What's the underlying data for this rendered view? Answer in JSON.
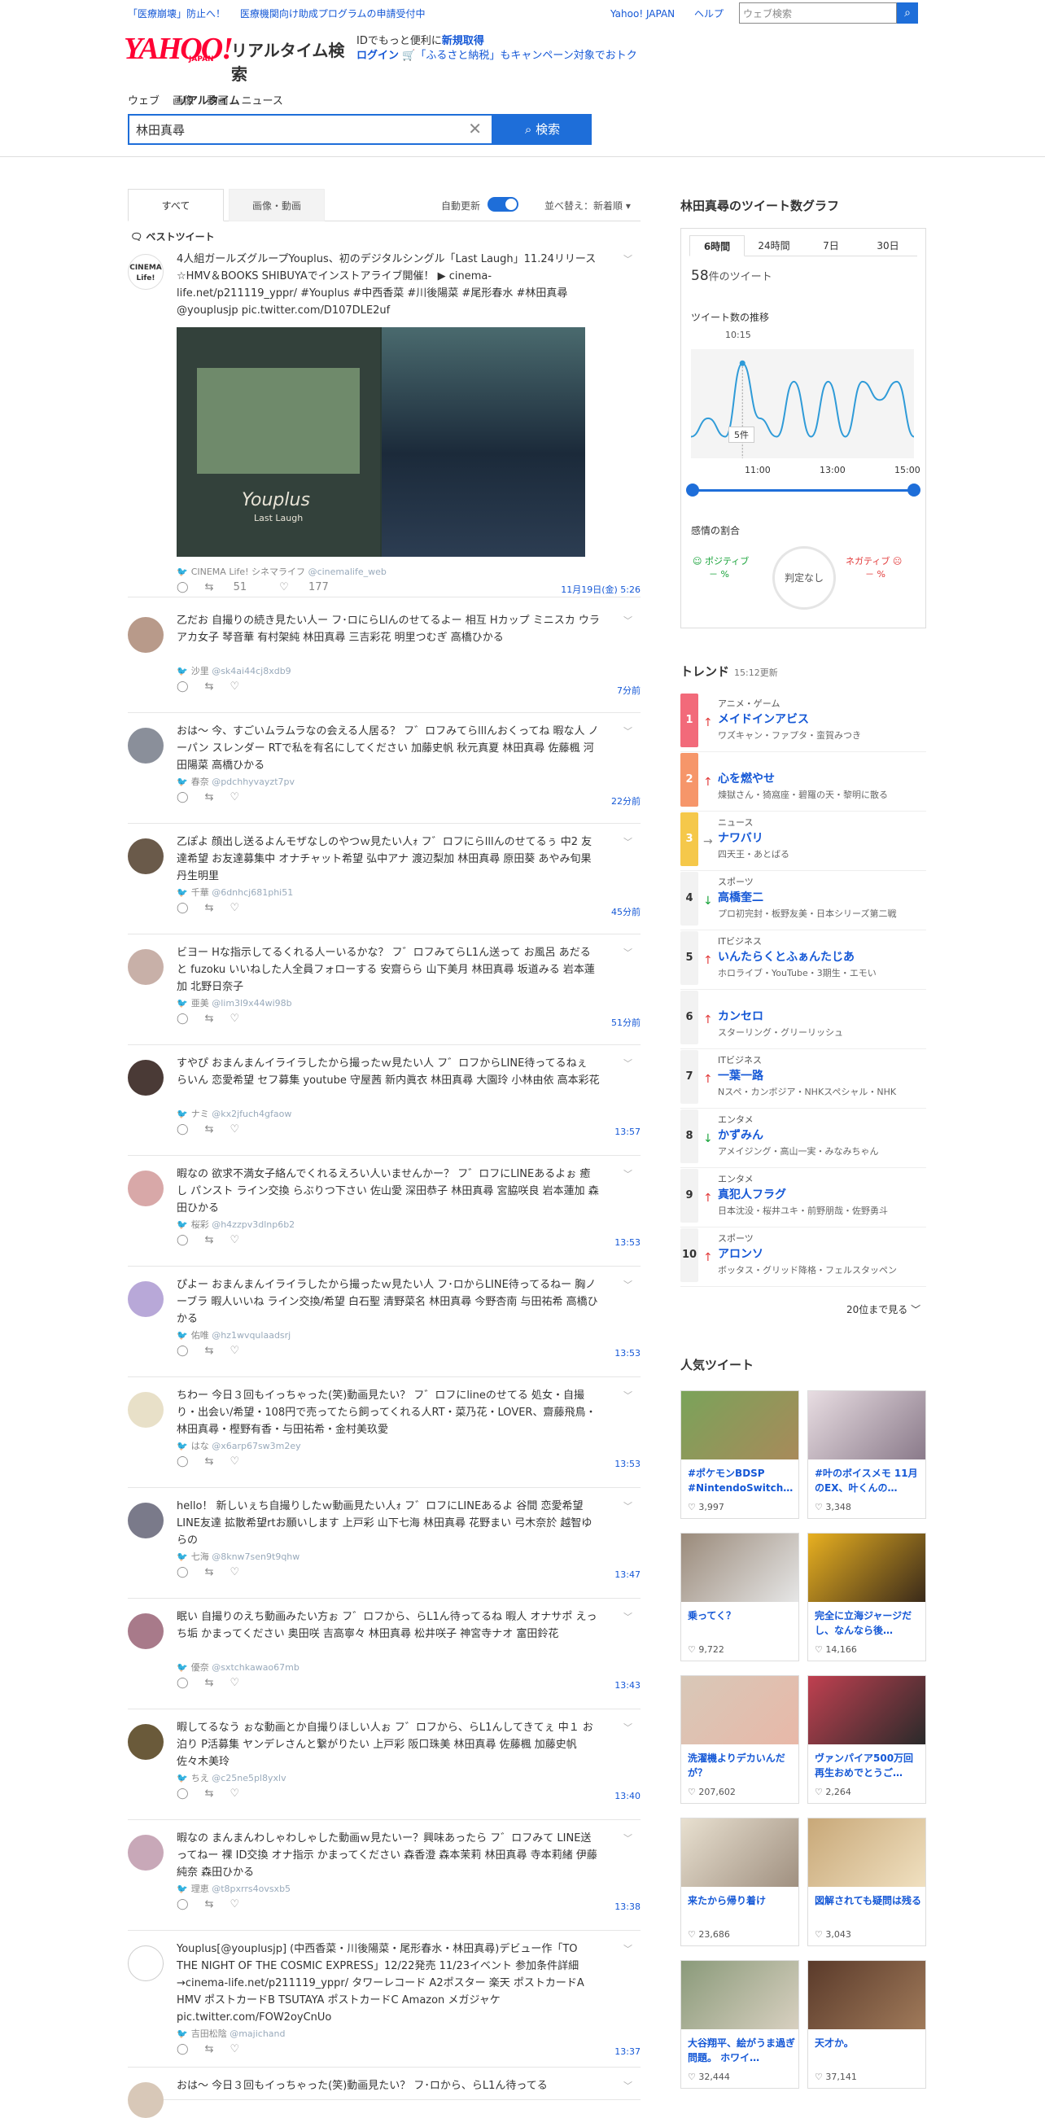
{
  "header": {
    "promo1": "「医療崩壊」防止へ！",
    "promo2": "医療機関向け助成プログラムの申請受付中",
    "link_yahoo": "Yahoo! JAPAN",
    "link_help": "ヘルプ",
    "search_placeholder": "ウェブ検索",
    "logo": "YAHOO!",
    "logo_jp": "JAPAN",
    "service": "リアルタイム検索",
    "login_line1_pre": "IDでもっと便利に",
    "login_line1_link": "新規取得",
    "login_line2_link": "ログイン",
    "login_line2_text": "🛒「ふるさと納税」もキャンペーン対象でおトク"
  },
  "tabs": [
    "ウェブ",
    "画像",
    "動画",
    "リアルタイム",
    "ニュース"
  ],
  "search": {
    "query": "林田真尋",
    "button": "検索"
  },
  "filter": {
    "all": "すべて",
    "media": "画像・動画",
    "auto": "自動更新",
    "sort": "並べ替え：新着順"
  },
  "best_label": "ベストツイート",
  "tweets": [
    {
      "text": "4人組ガールズグループYouplus、初のデジタルシングル「Last Laugh」11.24リリース ☆HMV＆BOOKS SHIBUYAでインストアライブ開催！ ▶ cinema-life.net/p211119_yppr/ #Youplus #中西香菜 #川後陽菜 #尾形春水 #林田真尋 @youplusjp pic.twitter.com/D107DLE2uf",
      "name": "CINEMA Life! シネマライフ",
      "handle": "@cinemalife_web",
      "rt": "51",
      "like": "177",
      "time": "11月19日(金) 5:26",
      "img_title": "Youplus",
      "img_sub": "Last Laugh"
    },
    {
      "text": "乙だお 自撮りの続き見たい人ー フ･ロにらLlんのせてるよー 相互 Hカップ ミニスカ ウラアカ女子 琴音華 有村架純 林田真尋 三吉彩花 明里つむぎ 高橋ひかる",
      "name": "沙里",
      "handle": "@sk4ai44cj8xdb9",
      "time": "7分前"
    },
    {
      "text": "おは～ 今、すごいムラムラなの会える人居る？ フ゛ロフみてらlllんおくってね 暇な人 ノーパン スレンダー RTで私を有名にしてください 加藤史帆 秋元真夏 林田真尋 佐藤楓 河田陽菜 高橋ひかる",
      "name": "春奈",
      "handle": "@pdchhyvayzt7pv",
      "time": "22分前"
    },
    {
      "text": "乙ぽよ 顔出し送るよんモザなしのやつｗ見たい人ｫ フ゛ロフにらlllんのせてるぅ 中2 友達希望 お友達募集中 オナチャット希望 弘中アナ 渡辺梨加 林田真尋 原田葵 あやみ旬果 丹生明里",
      "name": "千華",
      "handle": "@6dnhcj681phi51",
      "time": "45分前"
    },
    {
      "text": "ビヨー Hな指示してるくれる人ーいるかな？ フ゛ロフみてらL1ん送って お風呂 あだると fuzoku いいねした人全員フォローする 安齋らら 山下美月 林田真尋 坂道みる 岩本蓮加 北野日奈子",
      "name": "亜美",
      "handle": "@lim3l9x44wi98b",
      "time": "51分前"
    },
    {
      "text": "すやぴ おまんまんイライラしたから撮ったｗ見たい人 フ゛ロフからLINE待ってるねぇ らいん 恋愛希望 セフ募集 youtube 守屋茜 新内眞衣 林田真尋 大園玲 小林由依 高本彩花",
      "name": "ナミ",
      "handle": "@kx2jfuch4gfaow",
      "time": "13:57"
    },
    {
      "text": "暇なの 欲求不満女子絡んでくれるえろい人いませんかー？ フ゛ロフにLINEあるよぉ 癒し パンスト ライン交換 らぶりつ下さい 佐山愛 深田恭子 林田真尋 宮脇咲良 岩本蓮加 森田ひかる",
      "name": "桜彩",
      "handle": "@h4zzpv3dlnp6b2",
      "time": "13:53"
    },
    {
      "text": "ぴよー おまんまんイライラしたから撮ったｗ見たい人 フ･ロからLINE待ってるねー 胸ノーブラ 暇人いいね ライン交換/希望 白石聖 清野菜名 林田真尋 今野杏南 与田祐希 高橋ひかる",
      "name": "佑唯",
      "handle": "@hz1wvqulaadsrj",
      "time": "13:53"
    },
    {
      "text": "ちわー 今日３回もイっちゃった(笑)動画見たい？ フ゛ロフにlineのせてる 処女・自撮り・出会い/希望・108円で売ってたら飼ってくれる人RT・菜乃花・LOVER、齋藤飛鳥・林田真尋・樫野有香・与田祐希・金村美玖愛",
      "name": "はな",
      "handle": "@x6arp67sw3m2ey",
      "time": "13:53"
    },
    {
      "text": "hello！ 新しいぇち自撮りしたｗ動画見たい人ｫ フ゛ロフにLINEあるよ 谷間 恋愛希望 LINE友達 拡散希望rtお願いします 上戸彩 山下七海 林田真尋 花野まい 弓木奈於 越智ゆらの",
      "name": "七海",
      "handle": "@8knw7sen9t9qhw",
      "time": "13:47"
    },
    {
      "text": "眠い 自撮りのえち動画みたい方ぉ フ゛ロフから、らL1ん待ってるね 暇人 オナサポ えっち垢 かまってください 奥田咲 吉高寧々 林田真尋 松井咲子 神宮寺ナオ 富田鈴花",
      "name": "優奈",
      "handle": "@sxtchkawao67mb",
      "time": "13:43"
    },
    {
      "text": "暇してるなう ぉな動画とか自撮りほしい人ぉ フ゛ロフから、らL1んしてきてぇ 中１ お泊り P活募集 ヤンデレさんと繋がりたい 上戸彩 阪口珠美 林田真尋 佐藤楓 加藤史帆 佐々木美玲",
      "name": "ちえ",
      "handle": "@c25ne5pl8yxlv",
      "time": "13:40"
    },
    {
      "text": "暇なの まんまんわしゃわしゃした動画ｗ見たいー？興味あったら フ゛ロフみて LINE送ってねー 裸 ID交換 オナ指示 かまってください 森香澄 森本茉莉 林田真尋 寺本莉緒 伊藤純奈 森田ひかる",
      "name": "理恵",
      "handle": "@t8pxrrs4ovsxb5",
      "time": "13:38"
    },
    {
      "text": "Youplus[@youplusjp] (中西香菜・川後陽菜・尾形春水・林田真尋)デビュー作「TO THE NIGHT OF THE COSMIC EXPRESS」12/22発売 11/23イベント 参加条件詳細→cinema-life.net/p211119_yppr/ タワーレコード A2ポスター 楽天 ポストカードA HMV ポストカードB TSUTAYA ポストカードC Amazon メガジャケ pic.twitter.com/FOW2oyCnUo",
      "name": "吉田松陰",
      "handle": "@majichand",
      "time": "13:37"
    },
    {
      "text": "おは～ 今日３回もイっちゃった(笑)動画見たい？ フ･ロから、らL1ん待ってる"
    }
  ],
  "graph": {
    "title": "林田真尋のツイート数グラフ",
    "tabs": [
      "6時間",
      "24時間",
      "7日",
      "30日"
    ],
    "count": "58",
    "count_suffix": "件のツイート",
    "sub": "ツイート数の推移",
    "peak_time": "10:15",
    "peak_label": "5件",
    "ticks": [
      "11:00",
      "13:00",
      "15:00"
    ],
    "emo_label": "感情の割合",
    "pos": "ポジティブ",
    "neg": "ネガティブ",
    "pos_val": "－ %",
    "neg_val": "－ %",
    "neutral": "判定なし"
  },
  "chart_data": {
    "type": "line",
    "x": [
      "09:00",
      "09:30",
      "10:00",
      "10:15",
      "10:30",
      "11:00",
      "11:30",
      "12:00",
      "12:30",
      "13:00",
      "13:30",
      "14:00",
      "14:30",
      "15:00"
    ],
    "values": [
      1,
      2,
      1,
      5,
      2,
      1,
      4,
      1,
      4,
      1,
      4,
      3,
      4,
      1
    ],
    "xlim_ticks": [
      "11:00",
      "13:00",
      "15:00"
    ]
  },
  "trend": {
    "title": "トレンド",
    "updated": "15:12更新",
    "more": "20位まで見る",
    "items": [
      {
        "rank": "1",
        "cat": "アニメ・ゲーム",
        "kw": "メイドインアビス",
        "rel": "ワズキャン・ファプタ・蛮賀みつき",
        "color": "#f26a7a",
        "arrow": "↑",
        "ac": "#e23a3a"
      },
      {
        "rank": "2",
        "cat": "",
        "kw": "心を燃やせ",
        "rel": "煉獄さん・猗窩座・碧羅の天・黎明に散る",
        "color": "#f6966a",
        "arrow": "↑",
        "ac": "#e23a3a"
      },
      {
        "rank": "3",
        "cat": "ニュース",
        "kw": "ナワバリ",
        "rel": "四天王・あとばる",
        "color": "#f5c84a",
        "arrow": "→",
        "ac": "#888"
      },
      {
        "rank": "4",
        "cat": "スポーツ",
        "kw": "高橋奎二",
        "rel": "プロ初完封・板野友美・日本シリーズ第二戦",
        "color": "#f2f2f2",
        "arrow": "↓",
        "ac": "#18a33a"
      },
      {
        "rank": "5",
        "cat": "ITビジネス",
        "kw": "いんたらくとふぁんたじあ",
        "rel": "ホロライブ・YouTube・3期生・エモい",
        "color": "#f2f2f2",
        "arrow": "↑",
        "ac": "#e23a3a"
      },
      {
        "rank": "6",
        "cat": "",
        "kw": "カンセロ",
        "rel": "スターリング・グリーリッシュ",
        "color": "#f2f2f2",
        "arrow": "↑",
        "ac": "#e23a3a"
      },
      {
        "rank": "7",
        "cat": "ITビジネス",
        "kw": "一葉一路",
        "rel": "Nスペ・カンボジア・NHKスペシャル・NHK",
        "color": "#f2f2f2",
        "arrow": "↑",
        "ac": "#e23a3a"
      },
      {
        "rank": "8",
        "cat": "エンタメ",
        "kw": "かずみん",
        "rel": "アメイジング・高山一実・みなみちゃん",
        "color": "#f2f2f2",
        "arrow": "↓",
        "ac": "#18a33a"
      },
      {
        "rank": "9",
        "cat": "エンタメ",
        "kw": "真犯人フラグ",
        "rel": "日本沈没・桜井ユキ・前野朋哉・佐野勇斗",
        "color": "#f2f2f2",
        "arrow": "↑",
        "ac": "#e23a3a"
      },
      {
        "rank": "10",
        "cat": "スポーツ",
        "kw": "アロンソ",
        "rel": "ボッタス・グリッド降格・フェルスタッペン",
        "color": "#f2f2f2",
        "arrow": "↑",
        "ac": "#e23a3a"
      }
    ]
  },
  "popular": {
    "title": "人気ツイート",
    "cards": [
      {
        "title": "#ポケモンBDSP #NintendoSwitch…",
        "likes": "3,997",
        "c1": "#7aa35a",
        "c2": "#a88a5a"
      },
      {
        "title": "#叶のボイスメモ 11月のEX、叶くんの…",
        "likes": "3,348",
        "c1": "#e8dde2",
        "c2": "#8a7a8a"
      },
      {
        "title": "乗ってく？",
        "likes": "9,722",
        "c1": "#9a8a7a",
        "c2": "#e6e6e6"
      },
      {
        "title": "完全に立海ジャージだし、なんなら後…",
        "likes": "14,166",
        "c1": "#e8b020",
        "c2": "#3a2a1a"
      },
      {
        "title": "洗濯機よりデカいんだが？",
        "likes": "207,602",
        "c1": "#d8c8b8",
        "c2": "#e8b8a8"
      },
      {
        "title": "ヴァンパイア500万回再生おめでとうご…",
        "likes": "2,264",
        "c1": "#c04050",
        "c2": "#2a2a2a"
      },
      {
        "title": "来たから帰り着け",
        "likes": "23,686",
        "c1": "#e8e0d0",
        "c2": "#a09080"
      },
      {
        "title": "図解されても疑問は残る",
        "likes": "3,043",
        "c1": "#c8a878",
        "c2": "#f0e0c0"
      },
      {
        "title": "大谷翔平、絵がうま過ぎ問題。 ホワイ…",
        "likes": "32,444",
        "c1": "#8a9a7a",
        "c2": "#d8d0c0"
      },
      {
        "title": "天才か。",
        "likes": "37,141",
        "c1": "#5a3a2a",
        "c2": "#a07a5a"
      }
    ]
  }
}
